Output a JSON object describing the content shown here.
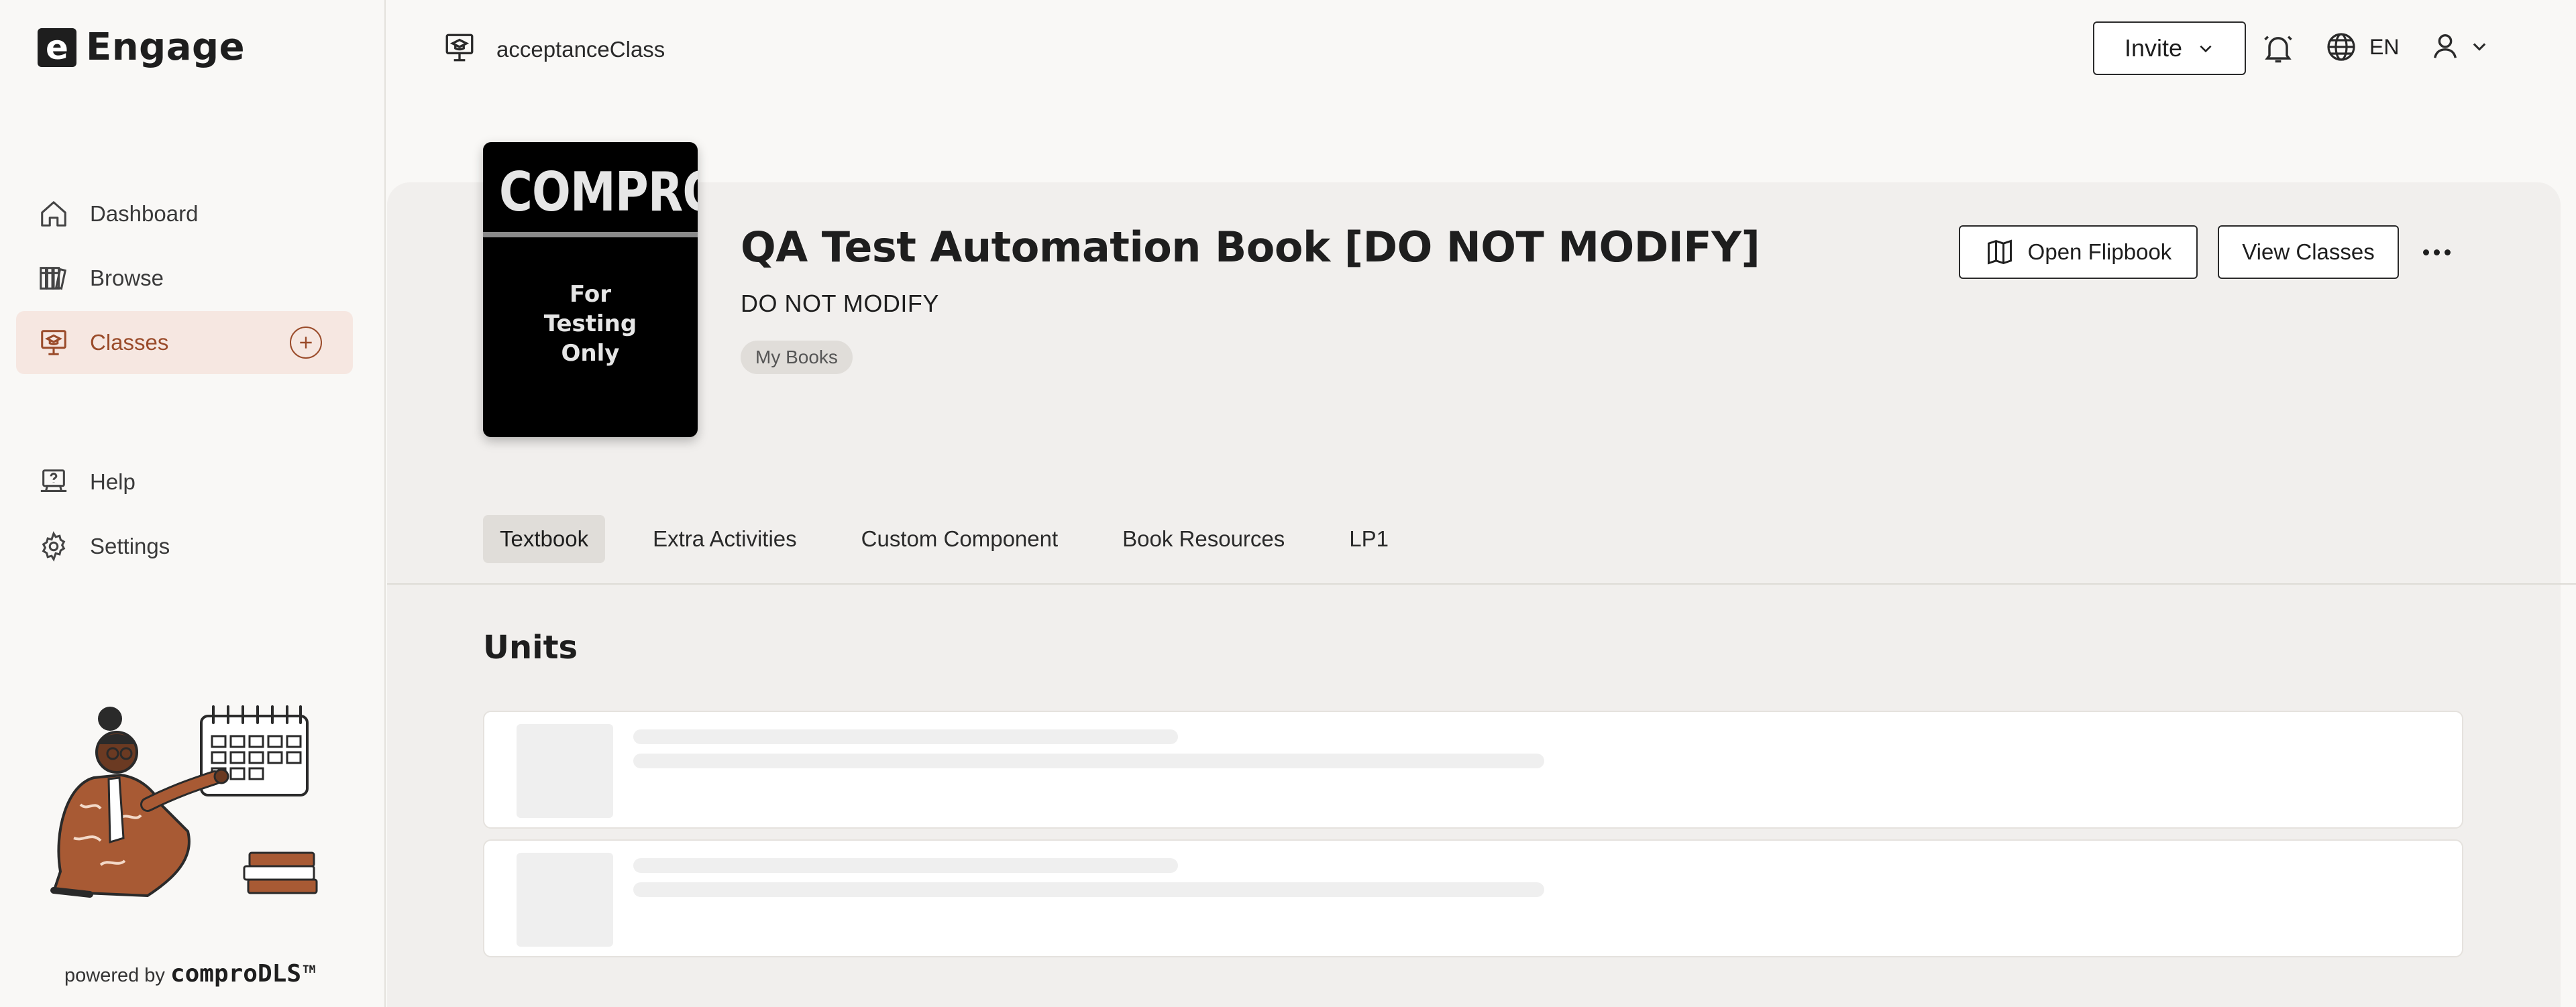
{
  "app": {
    "name": "Engage",
    "logo_letter": "e"
  },
  "sidebar": {
    "items": [
      {
        "label": "Dashboard",
        "icon": "home-icon"
      },
      {
        "label": "Browse",
        "icon": "library-icon"
      },
      {
        "label": "Classes",
        "icon": "classroom-icon",
        "active": true
      },
      {
        "label": "Help",
        "icon": "help-icon"
      },
      {
        "label": "Settings",
        "icon": "gear-icon"
      }
    ],
    "powered_by": "powered by",
    "brand": "comproDLS",
    "brand_tm": "TM"
  },
  "topbar": {
    "class_name": "acceptanceClass",
    "invite_label": "Invite",
    "language": "EN"
  },
  "book": {
    "cover_title": "COMPRO",
    "cover_subtitle": "For\nTesting\nOnly",
    "title": "QA Test Automation Book [DO NOT MODIFY]",
    "subtitle": "DO NOT MODIFY",
    "tag": "My Books",
    "open_flipbook_label": "Open Flipbook",
    "view_classes_label": "View Classes"
  },
  "tabs": [
    {
      "label": "Textbook",
      "active": true
    },
    {
      "label": "Extra Activities"
    },
    {
      "label": "Custom Component"
    },
    {
      "label": "Book Resources"
    },
    {
      "label": "LP1"
    }
  ],
  "units": {
    "heading": "Units"
  },
  "colors": {
    "accent": "#9a4b2a",
    "active_bg": "#f6e7e1",
    "panel_bg": "#f1efed",
    "page_bg": "#f9f8f6"
  }
}
